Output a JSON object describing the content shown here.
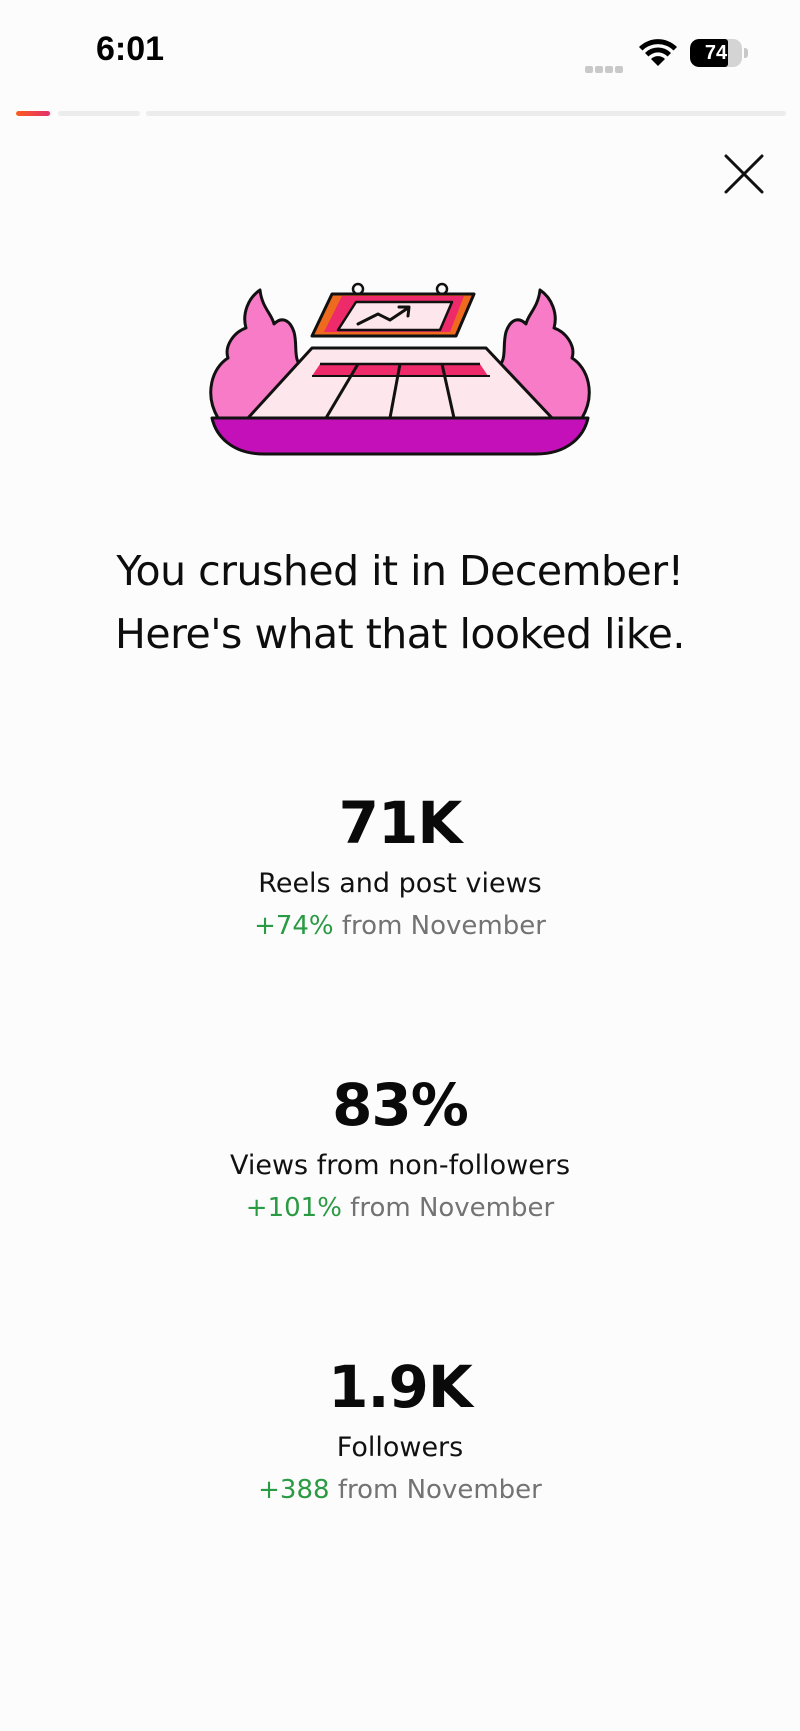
{
  "status_bar": {
    "time": "6:01",
    "battery_percent": 74,
    "battery_label": "74"
  },
  "story_progress": {
    "segments": [
      {
        "fill": 0.95
      },
      {
        "fill": 0
      },
      {
        "fill": 0
      }
    ],
    "accent_colors": [
      "#ff5a1f",
      "#e1306c"
    ]
  },
  "illustration": {
    "icon": "flaming-chart-sleigh-illustration",
    "colors": {
      "flames": "#f77bc6",
      "base": "#c410b9",
      "banner": "#ee2a6a",
      "banner_accent": "#ee6a1f",
      "inner": "#fde6ec"
    }
  },
  "headline": {
    "line1": "You crushed it in December!",
    "line2": "Here's what that looked like."
  },
  "stats": [
    {
      "value": "71K",
      "label": "Reels and post views",
      "delta": "+74%",
      "comparison": "from November"
    },
    {
      "value": "83%",
      "label": "Views from non-followers",
      "delta": "+101%",
      "comparison": "from November"
    },
    {
      "value": "1.9K",
      "label": "Followers",
      "delta": "+388",
      "comparison": "from November"
    }
  ],
  "colors": {
    "positive_delta": "#2a9a43",
    "muted_text": "#737373"
  }
}
